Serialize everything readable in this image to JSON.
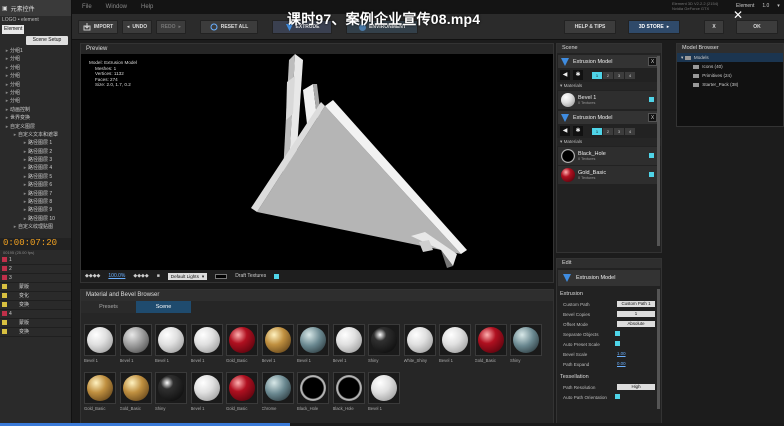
{
  "overlay_title": "课时97、案例企业宣传08.mp4",
  "ae": {
    "header_label": "元素控件",
    "sub_label": "LOGO • element",
    "element_tag": "Element",
    "scene_setup": "Scene Setup",
    "tree": [
      {
        "label": "分组1",
        "depth": 1
      },
      {
        "label": "分组",
        "depth": 1
      },
      {
        "label": "分组",
        "depth": 1
      },
      {
        "label": "分组",
        "depth": 1
      },
      {
        "label": "分组",
        "depth": 1
      },
      {
        "label": "分组",
        "depth": 1
      },
      {
        "label": "分组",
        "depth": 1
      },
      {
        "label": "动画控制",
        "depth": 1
      },
      {
        "label": "世界变换",
        "depth": 1
      },
      {
        "label": "自定义图层",
        "depth": 1
      },
      {
        "label": "自定义文本和遮罩",
        "depth": 2
      },
      {
        "label": "路径图层 1",
        "depth": 3
      },
      {
        "label": "路径图层 2",
        "depth": 3
      },
      {
        "label": "路径图层 3",
        "depth": 3
      },
      {
        "label": "路径图层 4",
        "depth": 3
      },
      {
        "label": "路径图层 5",
        "depth": 3
      },
      {
        "label": "路径图层 6",
        "depth": 3
      },
      {
        "label": "路径图层 7",
        "depth": 3
      },
      {
        "label": "路径图层 8",
        "depth": 3
      },
      {
        "label": "路径图层 9",
        "depth": 3
      },
      {
        "label": "路径图层 10",
        "depth": 3
      },
      {
        "label": "自定义纹理贴图",
        "depth": 2
      }
    ],
    "timecode": "0:00:07:20",
    "timecode_sub": "00195 (25.00 fps)",
    "layers": [
      {
        "num": "1",
        "name": "",
        "color": "red"
      },
      {
        "num": "2",
        "name": "",
        "color": "red"
      },
      {
        "num": "3",
        "name": "",
        "color": "red"
      },
      {
        "num": "",
        "name": "蒙版",
        "color": "yellow"
      },
      {
        "num": "",
        "name": "变化",
        "color": "yellow"
      },
      {
        "num": "",
        "name": "变换",
        "color": "yellow"
      },
      {
        "num": "4",
        "name": "",
        "color": "red"
      },
      {
        "num": "",
        "name": "蒙版",
        "color": "yellow"
      },
      {
        "num": "",
        "name": "变换",
        "color": "yellow"
      }
    ]
  },
  "menu": {
    "items": [
      "File",
      "Window",
      "Help"
    ],
    "version_line1": "Element 3D V2.2.2 (2154)",
    "version_line2": "Nvidia GeForce GTX",
    "right_items": [
      "Element",
      "1.0",
      "▾"
    ]
  },
  "toolbar": {
    "import": "IMPORT",
    "undo": "UNDO",
    "redo": "REDO",
    "reset_all": "RESET ALL",
    "extrude": "EXTRUDE",
    "environment": "ENVIRONMENT",
    "help": "HELP & TIPS",
    "store": "3D STORE",
    "x": "X",
    "ok": "OK"
  },
  "preview": {
    "title": "Preview",
    "info_model": "Model: Extrusion Model",
    "info_meshes": "Meshes: 1",
    "info_vertices": "Vertices: 1132",
    "info_faces": "Faces: 274",
    "info_size": "Size: 2.0, 1.7, 0.2",
    "zoom": "100.0%",
    "lights_select": "Default Lights",
    "draft_textures": "Draft Textures",
    "draft_on": true
  },
  "material_browser": {
    "title": "Material and Bevel Browser",
    "tabs": [
      "Presets",
      "Scene"
    ],
    "active_tab": "Scene",
    "swatches": [
      {
        "name": "Bevel 1",
        "kind": "white"
      },
      {
        "name": "Bevel 1",
        "kind": "grey"
      },
      {
        "name": "Bevel 1",
        "kind": "white"
      },
      {
        "name": "Bevel 1",
        "kind": "white"
      },
      {
        "name": "Gold_Basic",
        "kind": "red"
      },
      {
        "name": "Bevel 1",
        "kind": "gold"
      },
      {
        "name": "Bevel 1",
        "kind": "teal"
      },
      {
        "name": "Bevel 1",
        "kind": "white"
      },
      {
        "name": "Shiny",
        "kind": "black"
      },
      {
        "name": "White_Shiny",
        "kind": "white"
      },
      {
        "name": "Bevel 1",
        "kind": "white"
      },
      {
        "name": "Gold_Basic",
        "kind": "red"
      },
      {
        "name": "Shiny",
        "kind": "teal"
      },
      {
        "name": "Gold_Basic",
        "kind": "gold"
      },
      {
        "name": "Gold_Basic",
        "kind": "gold"
      },
      {
        "name": "Shiny",
        "kind": "black"
      },
      {
        "name": "Bevel 1",
        "kind": "white"
      },
      {
        "name": "Gold_Basic",
        "kind": "red"
      },
      {
        "name": "Chrome",
        "kind": "teal"
      },
      {
        "name": "Black_Hole",
        "kind": "hole"
      },
      {
        "name": "Black_Hole",
        "kind": "hole"
      },
      {
        "name": "Bevel 1",
        "kind": "white"
      }
    ]
  },
  "scene": {
    "title": "Scene",
    "objects": [
      {
        "name": "Extrusion Model",
        "close": "X",
        "groups": [
          "1",
          "2",
          "3",
          "4"
        ],
        "active_group": 0,
        "materials_label": "Materials",
        "materials": [
          {
            "name": "Bevel 1",
            "sub": "0 Textures",
            "kind": "white"
          }
        ]
      },
      {
        "name": "Extrusion Model",
        "close": "X",
        "groups": [
          "1",
          "2",
          "3",
          "4"
        ],
        "active_group": 0,
        "materials_label": "Materials",
        "materials": [
          {
            "name": "Black_Hole",
            "sub": "0 Textures",
            "kind": "hole"
          },
          {
            "name": "Gold_Basic",
            "sub": "0 Textures",
            "kind": "red"
          }
        ]
      }
    ]
  },
  "model_browser": {
    "title": "Model Browser",
    "root": "Models",
    "items": [
      "Icons (40)",
      "Primitives (24)",
      "Starter_Pack (38)"
    ]
  },
  "edit": {
    "title": "Edit",
    "object": "Extrusion Model",
    "section_extrusion": "Extrusion",
    "custom_path_label": "Custom Path",
    "custom_path_value": "Custom Path 1",
    "bevel_copies_label": "Bevel Copies",
    "bevel_copies_value": "1",
    "offset_mode_label": "Offset Mode",
    "offset_mode_value": "Absolute",
    "separate_objects_label": "Separate Objects",
    "auto_preset_label": "Auto Preset Scale",
    "bevel_scale_label": "Bevel Scale",
    "bevel_scale_value": "1.00",
    "path_expand_label": "Path Expand",
    "path_expand_value": "0.00",
    "section_tessellation": "Tessellation",
    "path_resolution_label": "Path Resolution",
    "path_resolution_value": "High",
    "auto_path_orient_label": "Auto Path Orientation"
  },
  "video_progress": 0.37,
  "colors": {
    "accent": "#4fd4e8",
    "tab_active": "#1f4b6e",
    "store": "#2f4a6a",
    "timecode": "#f0a020"
  }
}
